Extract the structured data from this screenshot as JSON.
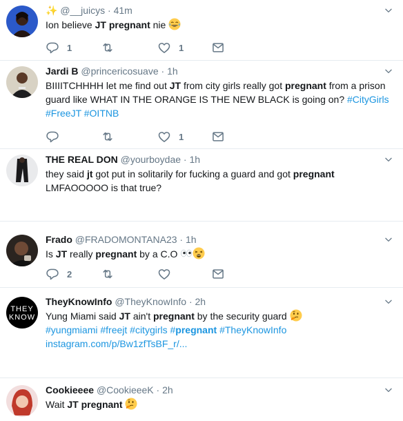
{
  "tweets": [
    {
      "name": "✨",
      "handle": "@__juicys",
      "time": "41m",
      "text_plain_1": "Ion believe ",
      "bold_1": "JT",
      "text_plain_2": " ",
      "bold_2": "pregnant",
      "text_plain_3": " nie",
      "emoji": "tears-of-joy-emoji",
      "reply_count": "1",
      "like_count": "1"
    },
    {
      "name": "Jardi B",
      "handle": "@princericosuave",
      "time": "1h",
      "line1_a": "BIIIITCHHHH let me find out ",
      "line1_b": "JT",
      "line1_c": " from city girls really got ",
      "line1_d": "pregnant",
      "line1_e": " from a prison",
      "line2_a": "guard like WHAT IN THE ORANGE IS THE NEW BLACK is going on? ",
      "line2_tag": "#CityGirls",
      "line3_tags": "#FreeJT #OITNB",
      "like_count": "1"
    },
    {
      "name": "THE REAL DON",
      "handle": "@yourboydae",
      "time": "1h",
      "line1_a": "they said ",
      "line1_b": "jt",
      "line1_c": " got put in solitarily for fucking a guard and got ",
      "line1_d": "pregnant",
      "line2": "LMFAOOOOO is that true?"
    },
    {
      "name": "Frado",
      "handle": "@FRADOMONTANA23",
      "time": "1h",
      "text_a": "Is ",
      "text_b": "JT",
      "text_c": " really ",
      "text_d": "pregnant",
      "text_e": " by a C.O",
      "reply_count": "2"
    },
    {
      "name": "TheyKnowInfo",
      "handle": "@TheyKnowInfo",
      "time": "2h",
      "line1_a": "Yung Miami said ",
      "line1_b": "JT",
      "line1_c": " ain't ",
      "line1_d": "pregnant",
      "line1_e": " by the security guard",
      "line2_tags_a": "#yungmiami #freejt #citygirls #",
      "line2_bold": "pregnant",
      "line2_tags_b": " #TheyKnowInfo",
      "line3_link": "instagram.com/p/Bw1zfTsBF_r/..."
    },
    {
      "name": "Cookieeee",
      "handle": "@CookieeeK",
      "time": "2h",
      "text_a": "Wait ",
      "text_b": "JT",
      "text_c": " ",
      "text_d": "pregnant"
    }
  ],
  "separator": "·",
  "colors": {
    "link": "#1b95e0",
    "muted": "#657786",
    "border": "#e6ecf0"
  },
  "icons": [
    "reply-icon",
    "retweet-icon",
    "like-icon",
    "dm-icon",
    "chevron-down-icon"
  ]
}
